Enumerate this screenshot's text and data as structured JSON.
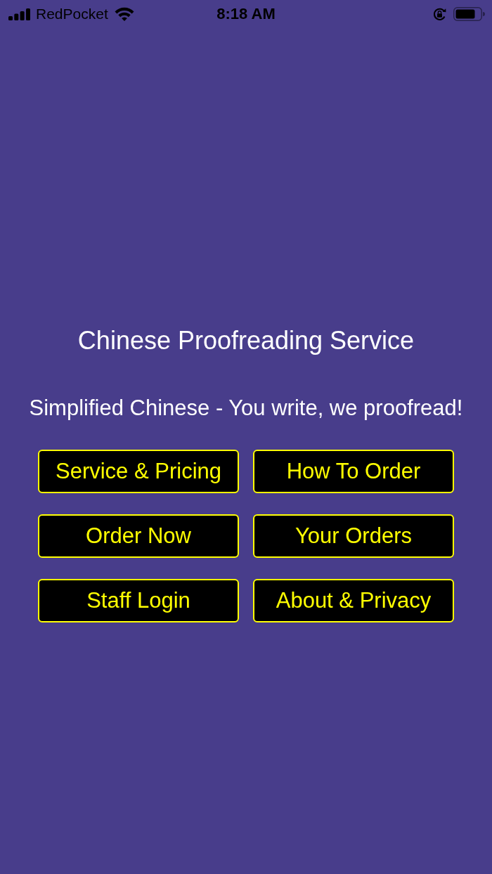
{
  "status_bar": {
    "carrier": "RedPocket",
    "time": "8:18 AM"
  },
  "title": "Chinese Proofreading Service",
  "subtitle": "Simplified Chinese - You write, we proofread!",
  "buttons": [
    "Service & Pricing",
    "How To Order",
    "Order Now",
    "Your Orders",
    "Staff Login",
    "About & Privacy"
  ]
}
